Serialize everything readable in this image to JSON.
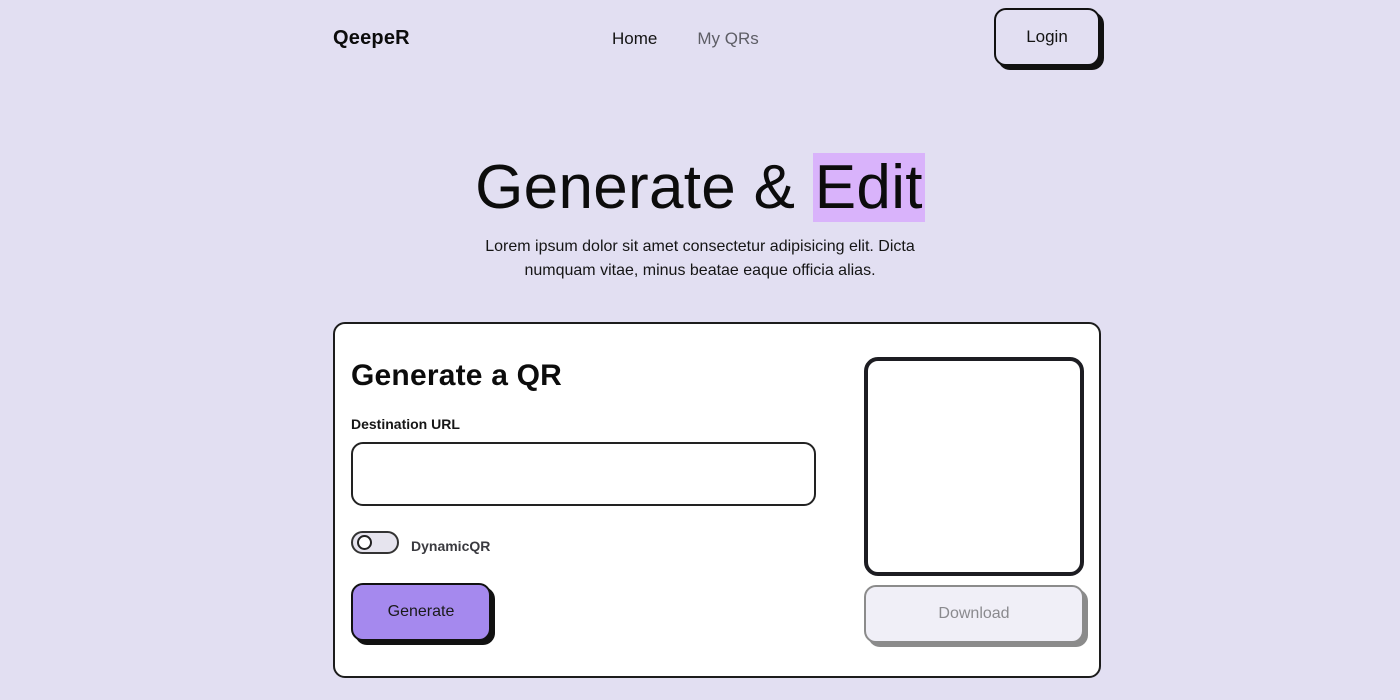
{
  "nav": {
    "brand": "QeepeR",
    "links": [
      {
        "label": "Home"
      },
      {
        "label": "My QRs"
      }
    ],
    "login_label": "Login"
  },
  "hero": {
    "title_main": "Generate & ",
    "title_highlight": "Edit",
    "subtitle": "Lorem ipsum dolor sit amet consectetur adipisicing elit. Dicta numquam vitae, minus beatae eaque officia alias.",
    "highlight_color": "#d9b3fb"
  },
  "card": {
    "title": "Generate a QR",
    "url_label": "Destination URL",
    "url_value": "",
    "url_placeholder": "",
    "dynamic_toggle_label": "DynamicQR",
    "dynamic_toggle_on": false,
    "generate_label": "Generate",
    "download_label": "Download"
  },
  "colors": {
    "background": "#e2dff2",
    "accent": "#a589ee",
    "card": "#ffffff"
  }
}
